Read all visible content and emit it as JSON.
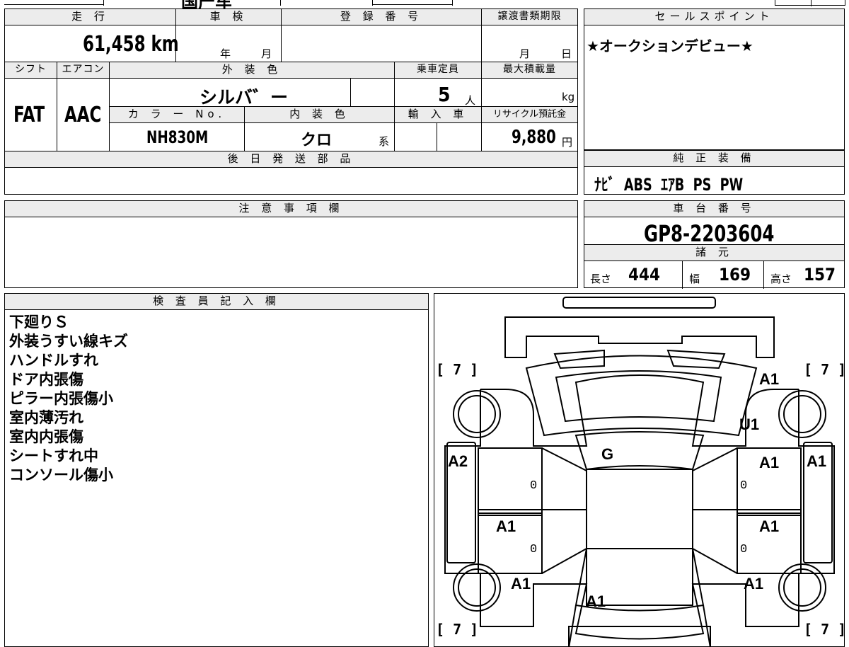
{
  "top_fragment": "国产车",
  "mileage": {
    "header": "走 行",
    "value": "61,458",
    "unit": "km"
  },
  "inspection": {
    "header": "車 検",
    "year_label": "年",
    "month_label": "月"
  },
  "registration": {
    "header": "登 録 番 号",
    "value": ""
  },
  "transfer": {
    "header": "譲渡書類期限",
    "month_label": "月",
    "day_label": "日"
  },
  "shift": {
    "header": "シフト",
    "value": "FAT"
  },
  "aircon": {
    "header": "エアコン",
    "value": "AAC"
  },
  "exterior_color": {
    "header": "外 装 色",
    "value": "シルバ゛ー"
  },
  "capacity": {
    "header": "乗車定員",
    "value": "5",
    "unit": "人"
  },
  "max_load": {
    "header": "最大積載量",
    "value": "",
    "unit": "kg"
  },
  "color_no": {
    "header": "カ ラ ー No.",
    "value": "NH830M"
  },
  "interior_color": {
    "header": "内 装 色",
    "value": "クロ",
    "suffix": "系"
  },
  "import": {
    "header": "輸 入 車"
  },
  "recycle": {
    "header": "リサイクル預託金",
    "value": "9,880",
    "unit": "円"
  },
  "later_parts": {
    "header": "後 日 発 送 部 品"
  },
  "sales_point": {
    "header": "セールスポイント",
    "text": "★オークションデビュー★"
  },
  "genuine_equipment": {
    "header": "純 正 装 備",
    "items": [
      "ﾅﾋﾞ",
      "ABS",
      "ｴｱB",
      "PS",
      "PW"
    ]
  },
  "notes": {
    "header": "注 意 事 項 欄"
  },
  "chassis": {
    "header": "車 台 番 号",
    "value": "GP8-2203604"
  },
  "specs": {
    "header": "諸 元",
    "length_label": "長さ",
    "length": "444",
    "width_label": "幅",
    "width": "169",
    "height_label": "高さ",
    "height": "157"
  },
  "inspector": {
    "header": "検 査 員 記 入 欄",
    "lines": [
      "下廻りＳ",
      "外装うすい線キズ",
      "ハンドルすれ",
      "ドア内張傷",
      "ピラー内張傷小",
      "室内薄汚れ",
      "室内内張傷",
      "シートすれ中",
      "コンソール傷小"
    ]
  },
  "diagram": {
    "tire_marks": [
      "[ 7 ]",
      "[ 7 ]",
      "[ 7 ]",
      "[ 7 ]"
    ],
    "damage": {
      "front_right_fender": "A1",
      "windshield_right": "U1",
      "roof": "G",
      "left_pillar": "A2",
      "right_front_door": "A1",
      "right_outer": "A1",
      "left_rear_door": "A1",
      "right_rear_door": "A1",
      "left_rear_fender": "A1",
      "right_rear_fender": "A1",
      "rear_hatch": "A1"
    },
    "zero_marks": [
      "0",
      "0",
      "0",
      "0"
    ]
  }
}
